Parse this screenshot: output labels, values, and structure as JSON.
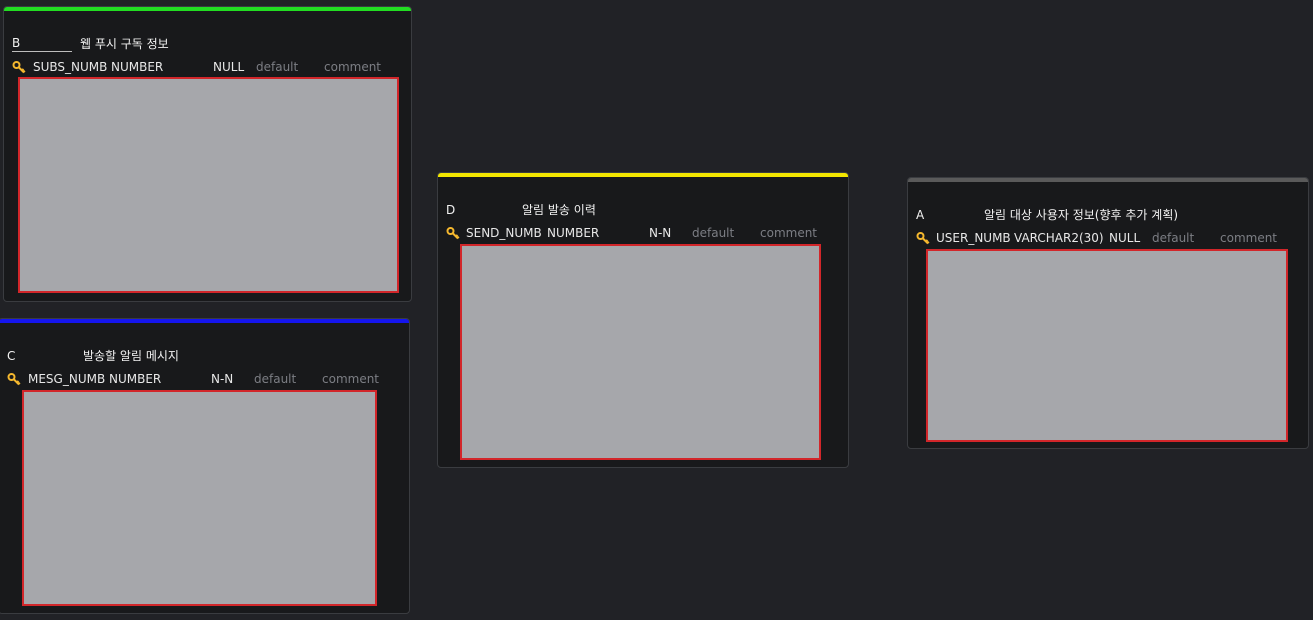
{
  "tables": {
    "b": {
      "alias": "B",
      "comment": "웹 푸시 구독 정보",
      "accent_color": "#22dd22",
      "column": {
        "name": "SUBS_NUMB",
        "type": "NUMBER",
        "nullable": "NULL",
        "default": "default",
        "comment": "comment"
      }
    },
    "c": {
      "alias": "C",
      "comment": "발송할 알림 메시지",
      "accent_color": "#1515ee",
      "column": {
        "name": "MESG_NUMB",
        "type": "NUMBER",
        "nullable": "N-N",
        "default": "default",
        "comment": "comment"
      }
    },
    "d": {
      "alias": "D",
      "comment": "알림 발송 이력",
      "accent_color": "#f2e600",
      "column": {
        "name": "SEND_NUMB",
        "type": "NUMBER",
        "nullable": "N-N",
        "default": "default",
        "comment": "comment"
      }
    },
    "a": {
      "alias": "A",
      "comment": "알림 대상 사용자 정보(향후 추가 계획)",
      "accent_color": "#5a5a5a",
      "column": {
        "name": "USER_NUMB",
        "type": "VARCHAR2(30)",
        "nullable": "NULL",
        "default": "default",
        "comment": "comment"
      }
    }
  },
  "icons": {
    "primary_key": "key-icon"
  },
  "colors": {
    "placeholder_fill": "#a6a7ab",
    "placeholder_border": "#d2262a",
    "key_icon": "#f5b82e"
  }
}
